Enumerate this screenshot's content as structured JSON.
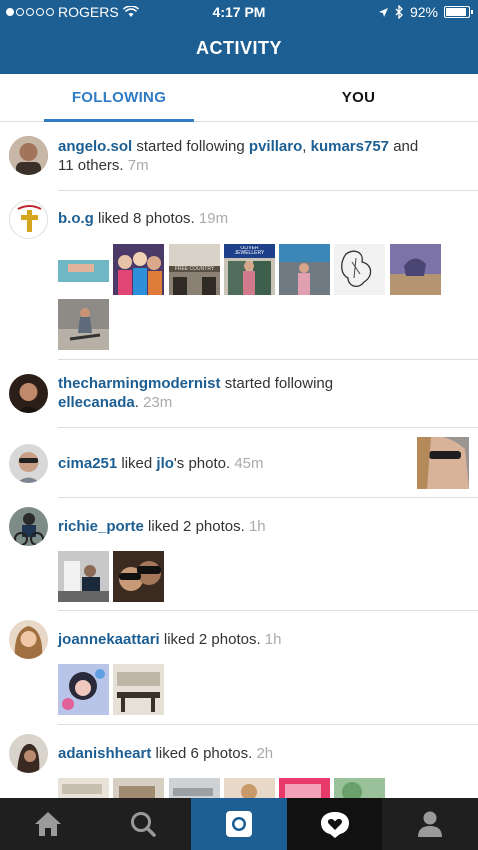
{
  "status": {
    "carrier": "ROGERS",
    "time": "4:17 PM",
    "battery": "92%",
    "battery_level": 0.92
  },
  "header": {
    "title": "ACTIVITY"
  },
  "tabs": {
    "following": "FOLLOWING",
    "you": "YOU"
  },
  "feed": [
    {
      "user": "angelo.sol",
      "text1": " started following ",
      "target1": "pvillaro",
      "comma": ", ",
      "target2": "kumars757",
      "text2": " and",
      "text3": "11 others. ",
      "time": "7m"
    },
    {
      "user": "b.o.g",
      "text": " liked 8 photos. ",
      "time": "19m"
    },
    {
      "user": "thecharmingmodernist",
      "text": " started following",
      "target": "ellecanada",
      "text2": ". ",
      "time": "23m"
    },
    {
      "user": "cima251",
      "text": " liked ",
      "target": "jlo",
      "text2": "'s photo. ",
      "time": "45m"
    },
    {
      "user": "richie_porte",
      "text": " liked 2 photos. ",
      "time": "1h"
    },
    {
      "user": "joannekaattari",
      "text": " liked 2 photos. ",
      "time": "1h"
    },
    {
      "user": "adanishheart",
      "text": " liked 6 photos. ",
      "time": "2h"
    }
  ],
  "bog_photo_labels": [
    "FREE COUNTRY",
    "OLIVER JEWELLERY"
  ],
  "colors": {
    "header": "#1d5f93",
    "link": "#1d5f93",
    "tab_active": "#2f7cc4",
    "timestamp": "#aaaaaa",
    "bottom_bar": "#1f1f1f"
  },
  "nav_icons": [
    "home-icon",
    "search-icon",
    "camera-icon",
    "activity-heart-icon",
    "profile-icon"
  ]
}
